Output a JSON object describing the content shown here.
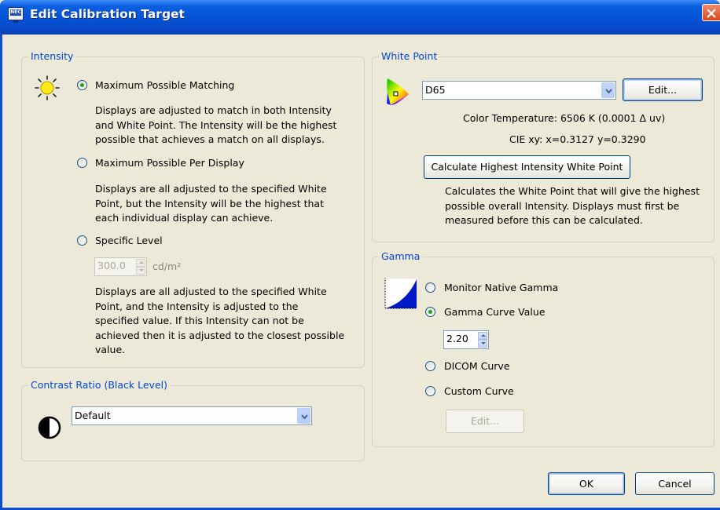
{
  "window": {
    "title": "Edit Calibration Target",
    "icon_name": "monitor-app-icon",
    "icon_text": "NEC"
  },
  "intensity": {
    "legend": "Intensity",
    "options": [
      {
        "label": "Maximum Possible Matching",
        "checked": true,
        "description": "Displays are adjusted to match in both Intensity\nand White Point. The Intensity will be the highest\npossible that achieves a match on all displays."
      },
      {
        "label": "Maximum Possible Per Display",
        "checked": false,
        "description": "Displays are all adjusted to the specified White\nPoint, but the Intensity will be the highest that\neach individual display can achieve."
      },
      {
        "label": "Specific Level",
        "checked": false,
        "description": "Displays are all adjusted to the specified White\nPoint, and the Intensity is adjusted to the\nspecified value. If this Intensity can not be\nachieved then it is adjusted to the closest possible\nvalue."
      }
    ],
    "level_value": "300.0",
    "level_unit": "cd/m²"
  },
  "contrast": {
    "legend": "Contrast Ratio (Black Level)",
    "selected": "Default"
  },
  "white_point": {
    "legend": "White Point",
    "selected": "D65",
    "edit_label": "Edit...",
    "color_temperature": "Color Temperature:  6506 K (0.0001 Δ uv)",
    "cie_xy": "CIE xy:  x=0.3127 y=0.3290",
    "calculate_label": "Calculate Highest Intensity White Point",
    "calculate_description": "Calculates the White Point that will give the highest\npossible overall Intensity. Displays must first be\nmeasured before this can be calculated."
  },
  "gamma": {
    "legend": "Gamma",
    "options": [
      {
        "label": "Monitor Native Gamma",
        "checked": false
      },
      {
        "label": "Gamma Curve Value",
        "checked": true
      },
      {
        "label": "DICOM Curve",
        "checked": false
      },
      {
        "label": "Custom Curve",
        "checked": false
      }
    ],
    "gamma_value": "2.20",
    "edit_label": "Edit..."
  },
  "buttons": {
    "ok": "OK",
    "cancel": "Cancel"
  },
  "colors": {
    "title_bar": "#0554d9",
    "group_legend": "#0046d5",
    "dialog_bg": "#ece9d8",
    "close_button": "#d9451c"
  }
}
